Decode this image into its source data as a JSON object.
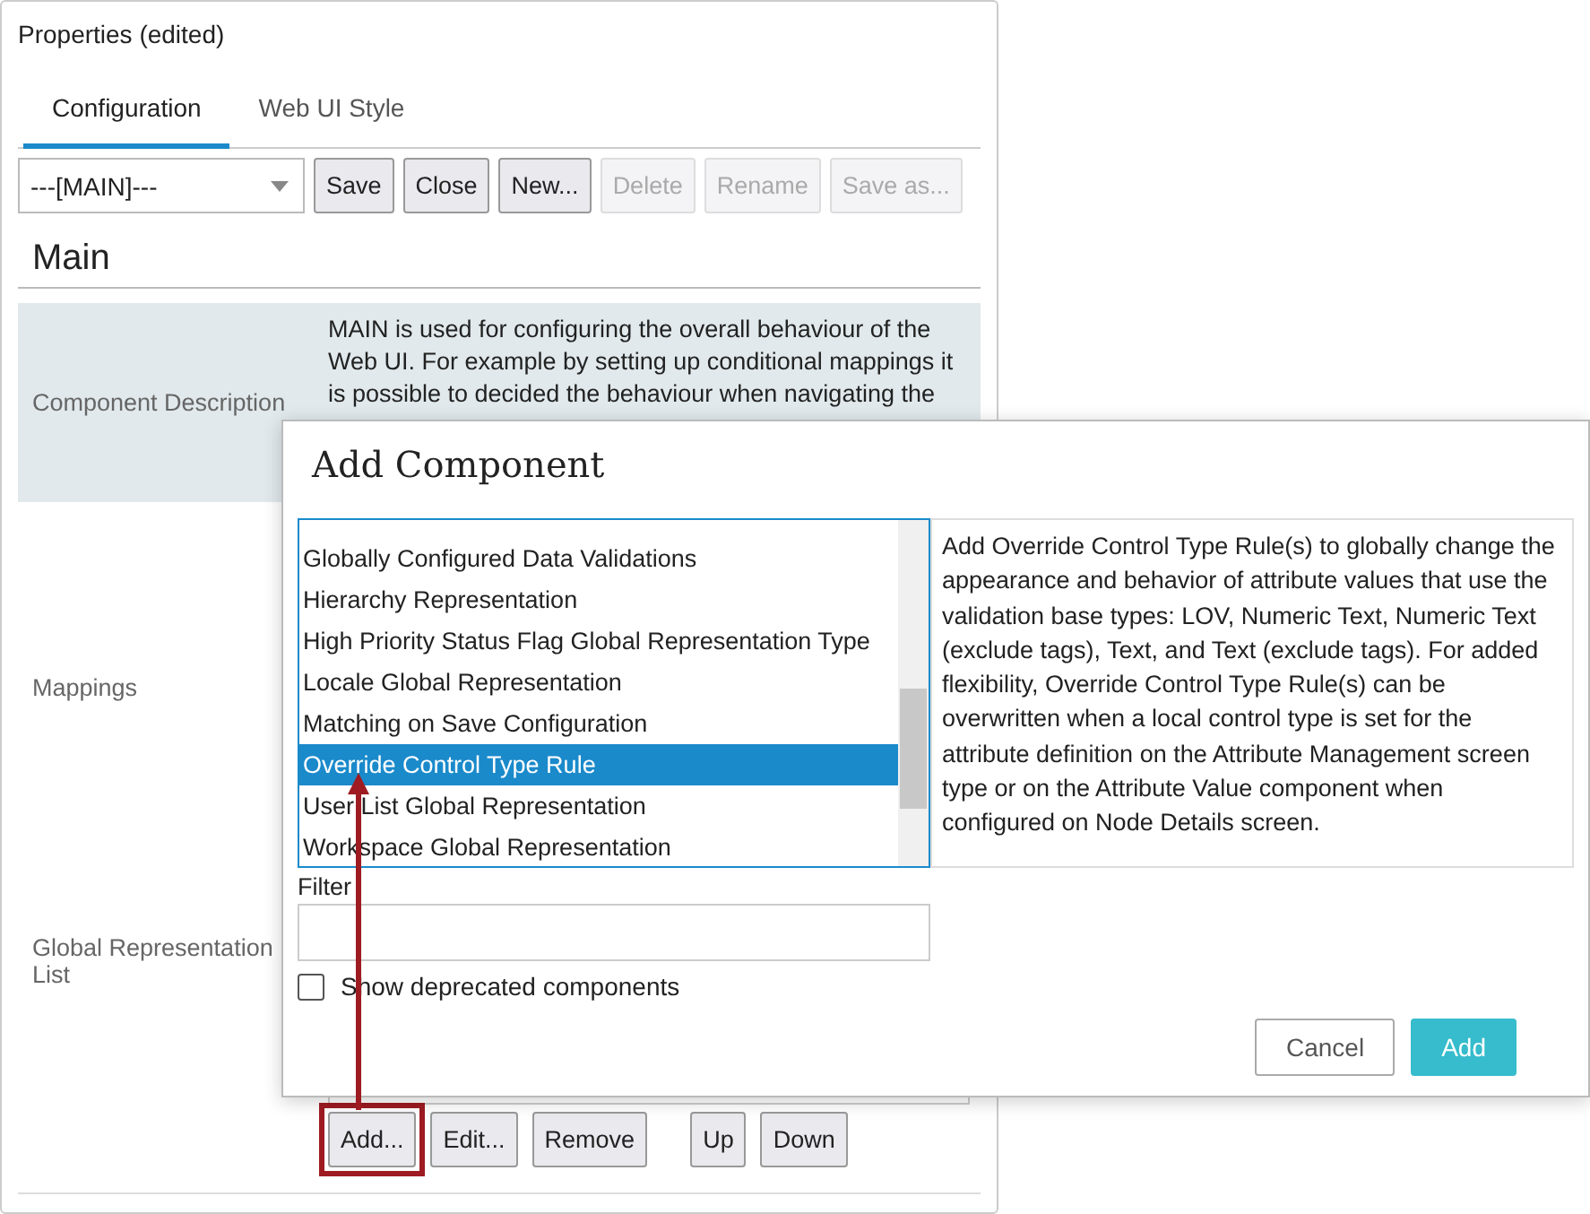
{
  "panel": {
    "title": "Properties (edited)",
    "tabs": [
      {
        "label": "Configuration",
        "selected": true
      },
      {
        "label": "Web UI Style",
        "selected": false
      }
    ],
    "config_select": {
      "value": "---[MAIN]---"
    },
    "toolbar_buttons": [
      {
        "label": "Save",
        "disabled": false
      },
      {
        "label": "Close",
        "disabled": false
      },
      {
        "label": "New...",
        "disabled": false
      },
      {
        "label": "Delete",
        "disabled": true
      },
      {
        "label": "Rename",
        "disabled": true
      },
      {
        "label": "Save as...",
        "disabled": true
      }
    ],
    "section_title": "Main",
    "description": {
      "label": "Component Description",
      "text": "MAIN is used for configuring the overall behaviour of the Web UI. For example by setting up conditional mappings it is possible to decided the behaviour when navigating the"
    },
    "mappings": {
      "label": "Mappings"
    },
    "representation_list": {
      "label": "Global Representation List"
    },
    "list_button_groups": [
      [
        {
          "label": "Add...",
          "highlighted": true
        },
        {
          "label": "Edit...",
          "highlighted": false
        },
        {
          "label": "Remove",
          "highlighted": false
        }
      ],
      [
        {
          "label": "Up",
          "highlighted": false
        },
        {
          "label": "Down",
          "highlighted": false
        }
      ]
    ]
  },
  "dialog": {
    "title": "Add Component",
    "components": [
      {
        "label": "Globally Configured Data Validations",
        "selected": false
      },
      {
        "label": "Hierarchy Representation",
        "selected": false
      },
      {
        "label": "High Priority Status Flag Global Representation Type",
        "selected": false
      },
      {
        "label": "Locale Global Representation",
        "selected": false
      },
      {
        "label": "Matching on Save Configuration",
        "selected": false
      },
      {
        "label": "Override Control Type Rule",
        "selected": true
      },
      {
        "label": "User List Global Representation",
        "selected": false
      },
      {
        "label": "Workspace Global Representation",
        "selected": false
      }
    ],
    "help_text": "Add Override Control Type Rule(s) to globally change the appearance and behavior of attribute values that use the validation base types: LOV, Numeric Text, Numeric Text (exclude tags), Text, and Text (exclude tags). For added flexibility, Override Control Type Rule(s) can be overwritten when a local control type is set for the attribute definition on the Attribute Management screen type or on the Attribute Value component when configured on Node Details screen.",
    "filter": {
      "label": "Filter"
    },
    "show_deprecated": {
      "label": "Show deprecated components",
      "checked": false
    },
    "buttons": [
      {
        "label": "Cancel",
        "kind": "secondary"
      },
      {
        "label": "Add",
        "kind": "primary"
      }
    ]
  }
}
